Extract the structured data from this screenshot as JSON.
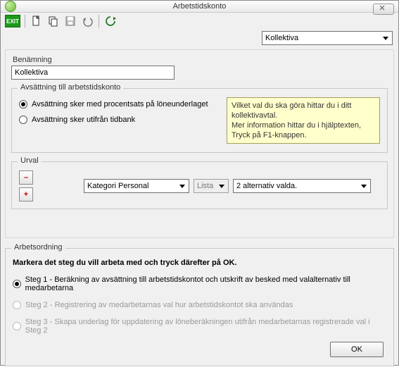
{
  "titlebar": {
    "title": "Arbetstidskonto",
    "close_glyph": "⬚"
  },
  "toolbar": {
    "exit": "EXIT"
  },
  "top_combo": {
    "value": "Kollektiva"
  },
  "panel1": {
    "benamning_label": "Benämning",
    "benamning_value": "Kollektiva",
    "group_legend": "Avsättning till arbetstidskonto",
    "opt1": "Avsättning sker med procentsats på löneunderlaget",
    "opt2": "Avsättning sker utifrån tidbank",
    "help_l1": "Vilket val du ska göra hittar du i ditt",
    "help_l2": "kollektivavtal.",
    "help_l3": "Mer information hittar du i hjälptexten,",
    "help_l4": "Tryck på F1-knappen.",
    "urval_legend": "Urval",
    "urval_cat": "Kategori Personal",
    "urval_lista": "Lista",
    "urval_sel": "2 alternativ valda."
  },
  "panel2": {
    "legend": "Arbetsordning",
    "instr": "Markera det steg du vill arbeta med och tryck därefter på OK.",
    "s1": "Steg 1 - Beräkning av avsättning till arbetstidskontot och utskrift av besked med valalternativ till medarbetarna",
    "s2": "Steg 2 - Registrering av medarbetarnas val hur arbetstidskontot ska användas",
    "s3": "Steg 3 - Skapa underlag för uppdatering av löneberäkningen utifrån medarbetarnas registrerade val i Steg 2",
    "ok": "OK"
  }
}
